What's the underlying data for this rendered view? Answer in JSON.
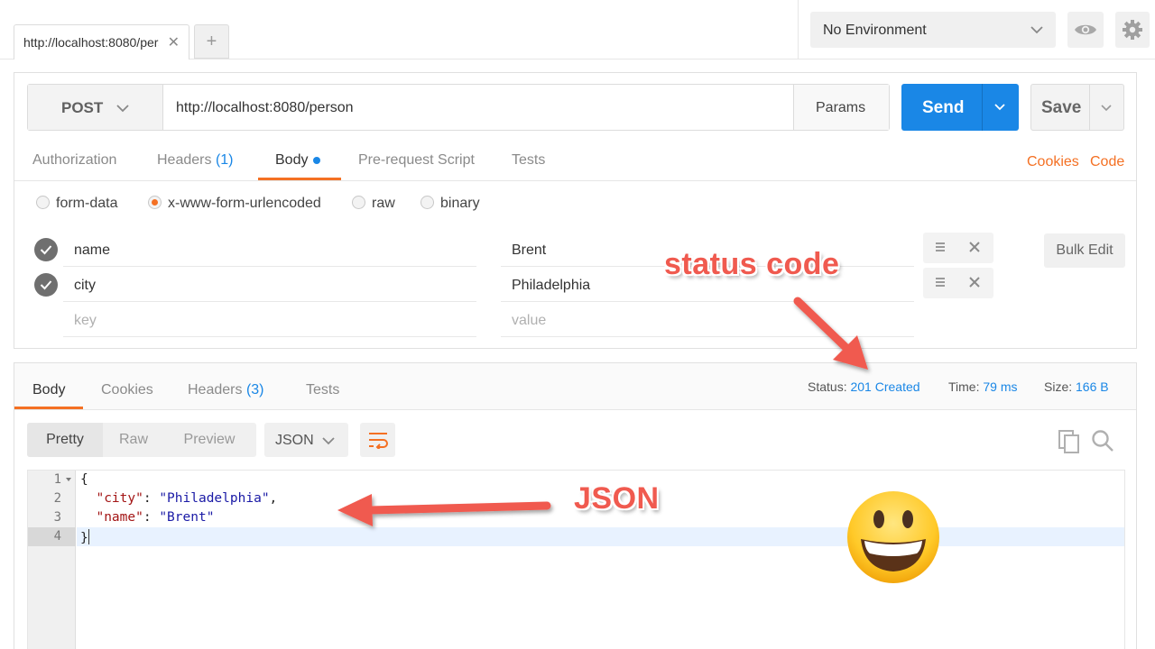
{
  "tabs": [
    {
      "label": "http://localhost:8080/person"
    }
  ],
  "tab_add_label": "+",
  "environment": {
    "selected": "No Environment"
  },
  "request": {
    "method": "POST",
    "url": "http://localhost:8080/person",
    "params_label": "Params",
    "send_label": "Send",
    "save_label": "Save"
  },
  "request_tabs": {
    "authorization": "Authorization",
    "headers": "Headers",
    "headers_count": "(1)",
    "body": "Body",
    "prerequest": "Pre-request Script",
    "tests": "Tests",
    "cookies": "Cookies",
    "code": "Code"
  },
  "body_modes": [
    {
      "label": "form-data",
      "selected": false
    },
    {
      "label": "x-www-form-urlencoded",
      "selected": true
    },
    {
      "label": "raw",
      "selected": false
    },
    {
      "label": "binary",
      "selected": false
    }
  ],
  "form_rows": [
    {
      "key": "name",
      "value": "Brent",
      "checked": true
    },
    {
      "key": "city",
      "value": "Philadelphia",
      "checked": true
    }
  ],
  "form_placeholder": {
    "key": "key",
    "value": "value"
  },
  "bulk_edit_label": "Bulk Edit",
  "response_tabs": {
    "body": "Body",
    "cookies": "Cookies",
    "headers": "Headers",
    "headers_count": "(3)",
    "tests": "Tests"
  },
  "response_meta": {
    "status_label": "Status:",
    "status_value": "201 Created",
    "time_label": "Time:",
    "time_value": "79 ms",
    "size_label": "Size:",
    "size_value": "166 B"
  },
  "view_modes": [
    "Pretty",
    "Raw",
    "Preview"
  ],
  "format": "JSON",
  "code_lines": {
    "n1": "1",
    "n2": "2",
    "n3": "3",
    "n4": "4",
    "open": "{",
    "key1": "\"city\"",
    "val1": "\"Philadelphia\"",
    "key2": "\"name\"",
    "val2": "\"Brent\"",
    "close": "}"
  },
  "annotations": {
    "status_code": "status code",
    "json": "JSON"
  },
  "colors": {
    "accent_orange": "#f47023",
    "send_blue": "#1a87e6",
    "annotation_red": "#f05a4f"
  },
  "icons": [
    "close-icon",
    "chevron-down-icon",
    "eye-icon",
    "gear-icon",
    "check-icon",
    "drag-handle-icon",
    "delete-icon",
    "wrap-icon",
    "copy-icon",
    "search-icon",
    "smiley-emoji"
  ]
}
